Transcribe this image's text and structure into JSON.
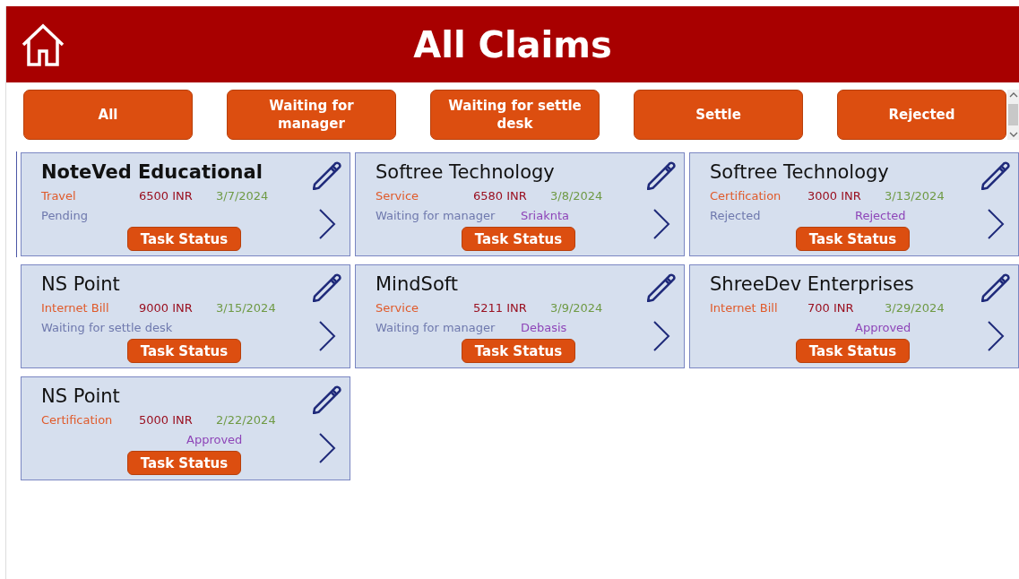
{
  "header": {
    "title": "All Claims"
  },
  "filters": [
    "All",
    "Waiting for manager",
    "Waiting for settle desk",
    "Settle",
    "Rejected"
  ],
  "claims": [
    {
      "title": "NoteVed Educational",
      "category": "Travel",
      "amount": "6500 INR",
      "date": "3/7/2024",
      "status": "Pending",
      "action": "Task Status",
      "selected": true
    },
    {
      "title": "Softree Technology",
      "category": "Service",
      "amount": "6580 INR",
      "date": "3/8/2024",
      "status": "Waiting for manager",
      "approver": "Sriaknta",
      "action": "Task Status",
      "selected": false
    },
    {
      "title": "Softree Technology",
      "category": "Certification",
      "amount": "3000 INR",
      "date": "3/13/2024",
      "status": "Rejected",
      "approver": "Rejected",
      "action": "Task Status",
      "selected": false
    },
    {
      "title": "NS Point",
      "category": "Internet Bill",
      "amount": "9000 INR",
      "date": "3/15/2024",
      "status": "Waiting for settle desk",
      "action": "Task Status",
      "selected": false
    },
    {
      "title": "MindSoft",
      "category": "Service",
      "amount": "5211 INR",
      "date": "3/9/2024",
      "status": "Waiting for manager",
      "approver": "Debasis",
      "action": "Task Status",
      "selected": false
    },
    {
      "title": "ShreeDev Enterprises",
      "category": "Internet Bill",
      "amount": "700 INR",
      "date": "3/29/2024",
      "approver": "Approved",
      "action": "Task Status",
      "selected": false
    },
    {
      "title": "NS Point",
      "category": "Certification",
      "amount": "5000 INR",
      "date": "2/22/2024",
      "approver": "Approved",
      "action": "Task Status",
      "selected": false
    }
  ]
}
